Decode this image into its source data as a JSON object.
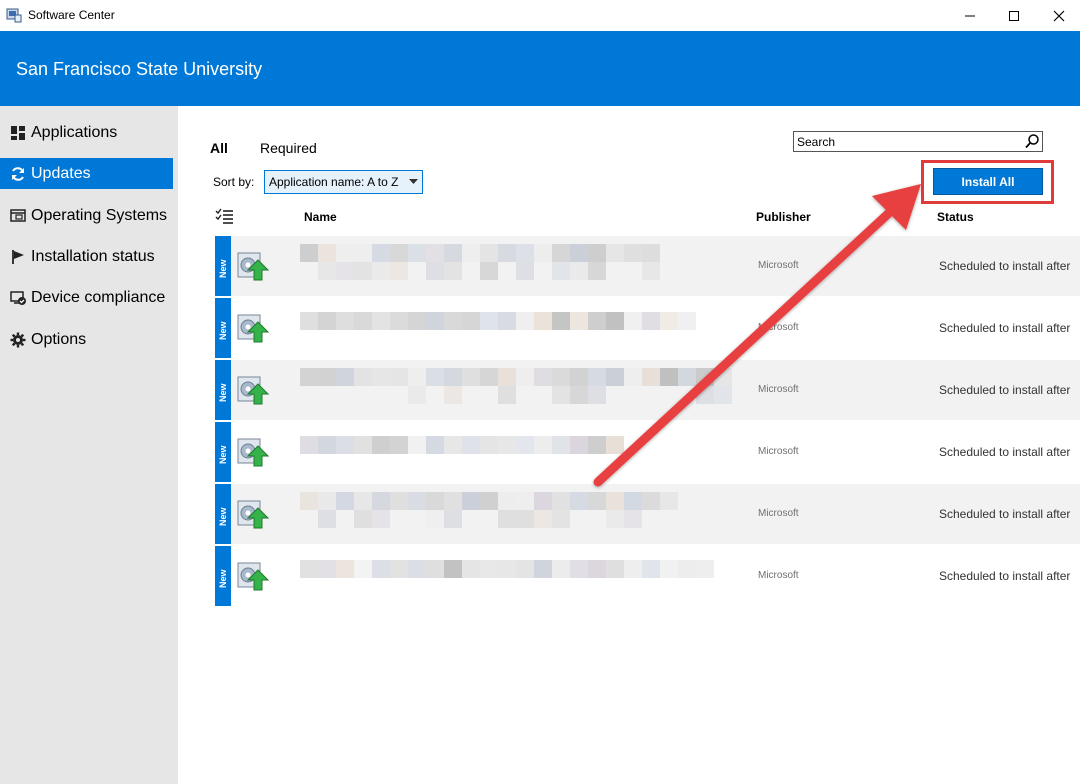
{
  "window": {
    "title": "Software Center",
    "minimize_icon": "minimize-icon",
    "maximize_icon": "maximize-icon",
    "close_icon": "close-icon"
  },
  "banner": {
    "organization": "San Francisco State University",
    "color": "#0078d7"
  },
  "sidebar": {
    "items": [
      {
        "label": "Applications",
        "icon": "applications-icon",
        "active": false
      },
      {
        "label": "Updates",
        "icon": "refresh-icon",
        "active": true
      },
      {
        "label": "Operating Systems",
        "icon": "operating-systems-icon",
        "active": false
      },
      {
        "label": "Installation status",
        "icon": "flag-icon",
        "active": false
      },
      {
        "label": "Device compliance",
        "icon": "compliance-icon",
        "active": false
      },
      {
        "label": "Options",
        "icon": "gear-icon",
        "active": false
      }
    ]
  },
  "filters": {
    "all": "All",
    "required": "Required"
  },
  "search": {
    "placeholder": "Search"
  },
  "sort": {
    "label": "Sort by:",
    "value": "Application name: A to Z"
  },
  "actions": {
    "install_all": "Install All"
  },
  "table": {
    "columns": {
      "name": "Name",
      "publisher": "Publisher",
      "status": "Status"
    },
    "rows": [
      {
        "tag": "New",
        "publisher": "Microsoft",
        "status": "Scheduled to install after"
      },
      {
        "tag": "New",
        "publisher": "Microsoft",
        "status": "Scheduled to install after"
      },
      {
        "tag": "New",
        "publisher": "Microsoft",
        "status": "Scheduled to install after"
      },
      {
        "tag": "New",
        "publisher": "Microsoft",
        "status": "Scheduled to install after"
      },
      {
        "tag": "New",
        "publisher": "Microsoft",
        "status": "Scheduled to install after"
      },
      {
        "tag": "New",
        "publisher": "Microsoft",
        "status": "Scheduled to install after"
      }
    ]
  },
  "annotation": {
    "color": "#e03b3b"
  }
}
